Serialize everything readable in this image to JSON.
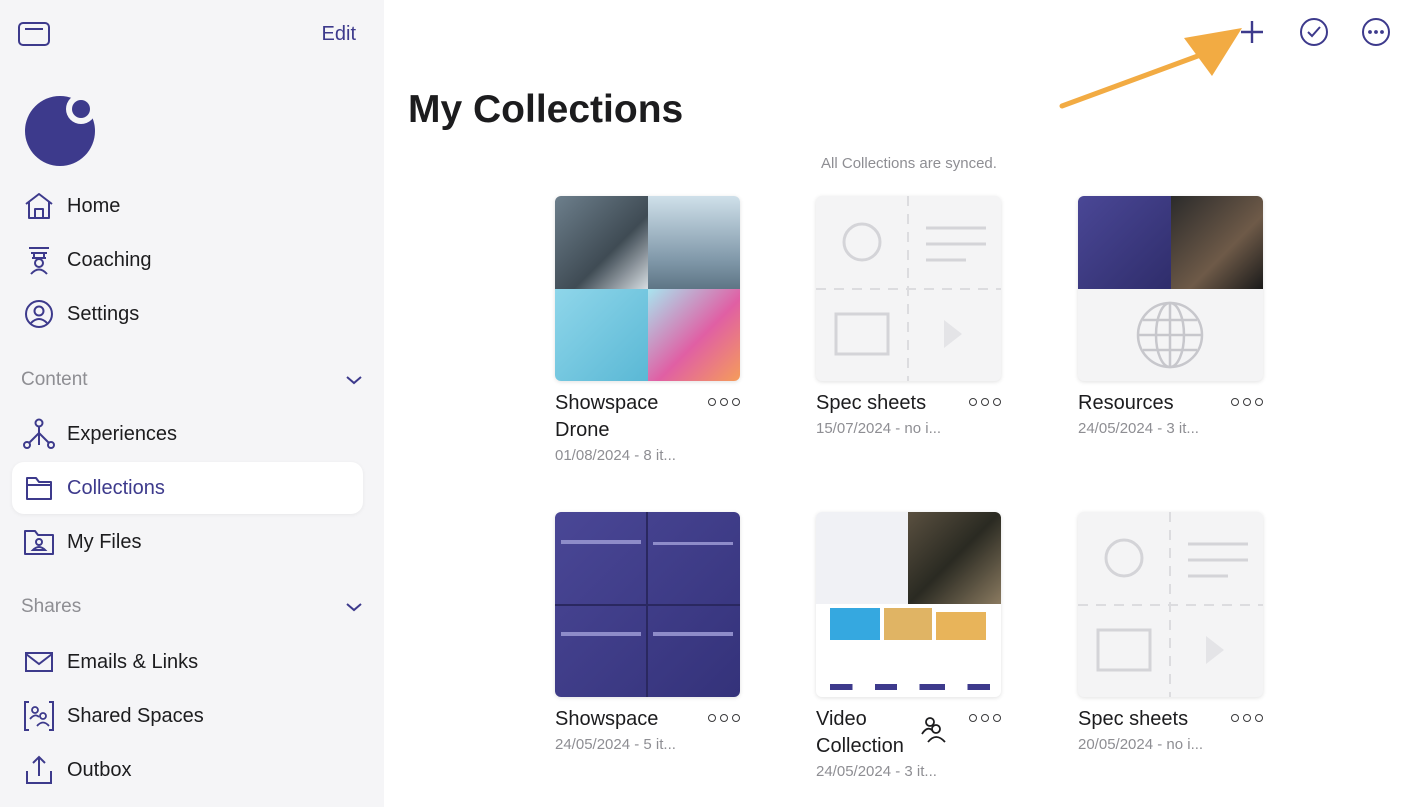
{
  "sidebar": {
    "edit_label": "Edit",
    "nav": [
      {
        "label": "Home",
        "icon": "home-icon"
      },
      {
        "label": "Coaching",
        "icon": "coaching-icon"
      },
      {
        "label": "Settings",
        "icon": "settings-icon"
      }
    ],
    "content_section": {
      "label": "Content",
      "items": [
        {
          "label": "Experiences",
          "icon": "experiences-icon"
        },
        {
          "label": "Collections",
          "icon": "folder-icon",
          "active": true
        },
        {
          "label": "My Files",
          "icon": "my-files-icon"
        }
      ]
    },
    "shares_section": {
      "label": "Shares",
      "items": [
        {
          "label": "Emails & Links",
          "icon": "mail-icon"
        },
        {
          "label": "Shared Spaces",
          "icon": "shared-spaces-icon"
        },
        {
          "label": "Outbox",
          "icon": "outbox-icon"
        }
      ]
    }
  },
  "header": {
    "title": "My Collections",
    "sync_status": "All Collections are synced.",
    "actions": [
      "plus-icon",
      "check-circle-icon",
      "more-circle-icon"
    ]
  },
  "collections": [
    {
      "title": "Showspace Drone",
      "meta": "01/08/2024 - 8 it..."
    },
    {
      "title": "Spec sheets",
      "meta": "15/07/2024 - no i..."
    },
    {
      "title": "Resources",
      "meta": "24/05/2024 - 3 it..."
    },
    {
      "title": "Showspace",
      "meta": "24/05/2024 - 5 it..."
    },
    {
      "title": "Video Collection",
      "meta": "24/05/2024 - 3 it...",
      "shared": true
    },
    {
      "title": "Spec sheets",
      "meta": "20/05/2024 - no i..."
    }
  ],
  "colors": {
    "accent": "#3d3a8c",
    "sidebar_bg": "#f5f5f7",
    "annotation_arrow": "#f2ab43"
  }
}
